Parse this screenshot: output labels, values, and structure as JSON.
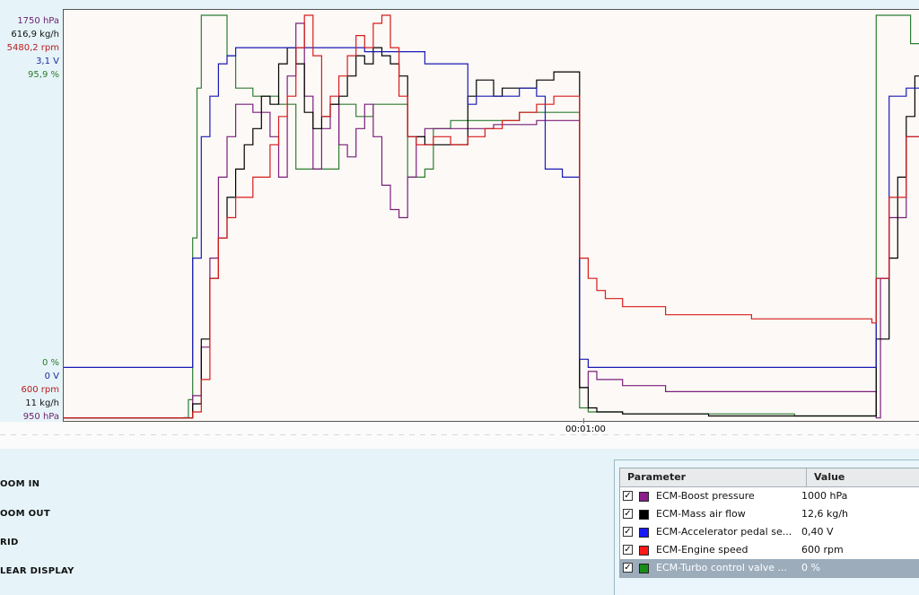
{
  "axis_labels_top": [
    {
      "text": "1750 hPa",
      "color": "#6b1f6b"
    },
    {
      "text": "616,9 kg/h",
      "color": "#111111"
    },
    {
      "text": "5480,2 rpm",
      "color": "#b81b1b"
    },
    {
      "text": "3,1 V",
      "color": "#1c2a9a"
    },
    {
      "text": "95,9 %",
      "color": "#2b7a2b"
    }
  ],
  "axis_labels_bottom": [
    {
      "text": "0 %",
      "color": "#2b7a2b"
    },
    {
      "text": "0 V",
      "color": "#1c2a9a"
    },
    {
      "text": "600 rpm",
      "color": "#b81b1b"
    },
    {
      "text": "11 kg/h",
      "color": "#111111"
    },
    {
      "text": "950 hPa",
      "color": "#6b1f6b"
    }
  ],
  "time_axis": {
    "label": "00:01:00"
  },
  "side_buttons": [
    "OOM IN",
    "OOM OUT",
    "RID",
    "LEAR DISPLAY"
  ],
  "param_table": {
    "header_param": "Parameter",
    "header_value": "Value",
    "rows": [
      {
        "name": "ECM-Boost pressure",
        "value": "1000 hPa",
        "color": "#8a1f8a",
        "checked": true,
        "selected": false
      },
      {
        "name": "ECM-Mass air flow",
        "value": "12,6 kg/h",
        "color": "#000000",
        "checked": true,
        "selected": false
      },
      {
        "name": "ECM-Accelerator pedal se...",
        "value": "0,40 V",
        "color": "#1a1aff",
        "checked": true,
        "selected": false
      },
      {
        "name": "ECM-Engine speed",
        "value": "600 rpm",
        "color": "#ff1a1a",
        "checked": true,
        "selected": false
      },
      {
        "name": "ECM-Turbo control valve ...",
        "value": "0 %",
        "color": "#1a8c1a",
        "checked": true,
        "selected": true
      }
    ]
  },
  "chart_data": {
    "type": "line",
    "xlabel": "",
    "x_ticks": [
      "00:01:00"
    ],
    "normalized_scale": [
      0,
      1
    ],
    "series": [
      {
        "name": "ECM-Turbo control valve ...",
        "color": "#2e7d32",
        "range": [
          "0 %",
          "95,9 %"
        ],
        "points": [
          [
            0,
            0.005
          ],
          [
            0.14,
            0.006
          ],
          [
            0.145,
            0.05
          ],
          [
            0.15,
            0.45
          ],
          [
            0.155,
            0.82
          ],
          [
            0.16,
            1.0
          ],
          [
            0.18,
            1.0
          ],
          [
            0.19,
            0.9
          ],
          [
            0.2,
            0.82
          ],
          [
            0.22,
            0.8
          ],
          [
            0.25,
            0.78
          ],
          [
            0.27,
            0.62
          ],
          [
            0.3,
            0.62
          ],
          [
            0.32,
            0.78
          ],
          [
            0.34,
            0.75
          ],
          [
            0.36,
            0.78
          ],
          [
            0.38,
            0.78
          ],
          [
            0.4,
            0.6
          ],
          [
            0.42,
            0.62
          ],
          [
            0.43,
            0.72
          ],
          [
            0.45,
            0.74
          ],
          [
            0.47,
            0.74
          ],
          [
            0.49,
            0.74
          ],
          [
            0.51,
            0.74
          ],
          [
            0.53,
            0.76
          ],
          [
            0.55,
            0.76
          ],
          [
            0.6,
            0.75
          ],
          [
            0.6,
            0.03
          ],
          [
            0.61,
            0.02
          ],
          [
            0.65,
            0.015
          ],
          [
            0.85,
            0.01
          ],
          [
            0.94,
            0.01
          ],
          [
            0.945,
            1.0
          ],
          [
            0.98,
            1.0
          ],
          [
            0.985,
            0.93
          ],
          [
            1.0,
            0.87
          ]
        ]
      },
      {
        "name": "ECM-Boost pressure",
        "color": "#7b1f7b",
        "range": [
          "950 hPa",
          "1750 hPa"
        ],
        "points": [
          [
            0,
            0.005
          ],
          [
            0.14,
            0.005
          ],
          [
            0.15,
            0.06
          ],
          [
            0.16,
            0.18
          ],
          [
            0.17,
            0.4
          ],
          [
            0.18,
            0.6
          ],
          [
            0.19,
            0.7
          ],
          [
            0.2,
            0.78
          ],
          [
            0.22,
            0.76
          ],
          [
            0.24,
            0.7
          ],
          [
            0.25,
            0.6
          ],
          [
            0.26,
            0.85
          ],
          [
            0.27,
            0.98
          ],
          [
            0.28,
            0.8
          ],
          [
            0.29,
            0.62
          ],
          [
            0.3,
            0.72
          ],
          [
            0.31,
            0.78
          ],
          [
            0.32,
            0.68
          ],
          [
            0.33,
            0.65
          ],
          [
            0.34,
            0.72
          ],
          [
            0.35,
            0.78
          ],
          [
            0.36,
            0.7
          ],
          [
            0.37,
            0.58
          ],
          [
            0.38,
            0.52
          ],
          [
            0.39,
            0.5
          ],
          [
            0.4,
            0.6
          ],
          [
            0.41,
            0.7
          ],
          [
            0.42,
            0.72
          ],
          [
            0.43,
            0.72
          ],
          [
            0.45,
            0.72
          ],
          [
            0.5,
            0.73
          ],
          [
            0.55,
            0.74
          ],
          [
            0.59,
            0.74
          ],
          [
            0.6,
            0.74
          ],
          [
            0.6,
            0.08
          ],
          [
            0.61,
            0.12
          ],
          [
            0.62,
            0.1
          ],
          [
            0.65,
            0.085
          ],
          [
            0.7,
            0.07
          ],
          [
            0.75,
            0.07
          ],
          [
            0.8,
            0.07
          ],
          [
            0.88,
            0.07
          ],
          [
            0.94,
            0.07
          ],
          [
            0.945,
            0.005
          ],
          [
            0.95,
            0.35
          ],
          [
            0.96,
            0.5
          ],
          [
            0.98,
            0.7
          ],
          [
            1.0,
            0.78
          ]
        ]
      },
      {
        "name": "ECM-Mass air flow",
        "color": "#000000",
        "range": [
          "11 kg/h",
          "616,9 kg/h"
        ],
        "points": [
          [
            0,
            0.005
          ],
          [
            0.14,
            0.005
          ],
          [
            0.15,
            0.04
          ],
          [
            0.16,
            0.2
          ],
          [
            0.17,
            0.35
          ],
          [
            0.18,
            0.45
          ],
          [
            0.19,
            0.55
          ],
          [
            0.2,
            0.62
          ],
          [
            0.21,
            0.68
          ],
          [
            0.22,
            0.72
          ],
          [
            0.23,
            0.8
          ],
          [
            0.24,
            0.78
          ],
          [
            0.25,
            0.88
          ],
          [
            0.26,
            0.92
          ],
          [
            0.27,
            0.88
          ],
          [
            0.28,
            0.76
          ],
          [
            0.29,
            0.72
          ],
          [
            0.3,
            0.75
          ],
          [
            0.31,
            0.78
          ],
          [
            0.32,
            0.8
          ],
          [
            0.33,
            0.85
          ],
          [
            0.34,
            0.9
          ],
          [
            0.35,
            0.88
          ],
          [
            0.36,
            0.92
          ],
          [
            0.37,
            0.9
          ],
          [
            0.38,
            0.88
          ],
          [
            0.39,
            0.85
          ],
          [
            0.4,
            0.7
          ],
          [
            0.42,
            0.68
          ],
          [
            0.44,
            0.68
          ],
          [
            0.46,
            0.68
          ],
          [
            0.47,
            0.8
          ],
          [
            0.48,
            0.84
          ],
          [
            0.5,
            0.8
          ],
          [
            0.51,
            0.82
          ],
          [
            0.53,
            0.82
          ],
          [
            0.55,
            0.84
          ],
          [
            0.57,
            0.86
          ],
          [
            0.6,
            0.86
          ],
          [
            0.6,
            0.08
          ],
          [
            0.61,
            0.03
          ],
          [
            0.62,
            0.02
          ],
          [
            0.65,
            0.015
          ],
          [
            0.75,
            0.01
          ],
          [
            0.88,
            0.01
          ],
          [
            0.94,
            0.01
          ],
          [
            0.945,
            0.2
          ],
          [
            0.96,
            0.4
          ],
          [
            0.97,
            0.6
          ],
          [
            0.98,
            0.75
          ],
          [
            0.99,
            0.85
          ],
          [
            1.0,
            0.78
          ]
        ]
      },
      {
        "name": "ECM-Accelerator pedal se...",
        "color": "#1a1ab5",
        "range": [
          "0 V",
          "3,1 V"
        ],
        "points": [
          [
            0,
            0.13
          ],
          [
            0.14,
            0.13
          ],
          [
            0.15,
            0.4
          ],
          [
            0.16,
            0.7
          ],
          [
            0.17,
            0.8
          ],
          [
            0.18,
            0.88
          ],
          [
            0.19,
            0.9
          ],
          [
            0.2,
            0.92
          ],
          [
            0.22,
            0.92
          ],
          [
            0.25,
            0.92
          ],
          [
            0.3,
            0.92
          ],
          [
            0.35,
            0.91
          ],
          [
            0.4,
            0.91
          ],
          [
            0.42,
            0.88
          ],
          [
            0.44,
            0.88
          ],
          [
            0.46,
            0.88
          ],
          [
            0.47,
            0.78
          ],
          [
            0.48,
            0.8
          ],
          [
            0.5,
            0.8
          ],
          [
            0.53,
            0.82
          ],
          [
            0.55,
            0.8
          ],
          [
            0.56,
            0.62
          ],
          [
            0.58,
            0.6
          ],
          [
            0.6,
            0.6
          ],
          [
            0.6,
            0.15
          ],
          [
            0.61,
            0.13
          ],
          [
            0.65,
            0.13
          ],
          [
            0.75,
            0.13
          ],
          [
            0.85,
            0.13
          ],
          [
            0.94,
            0.13
          ],
          [
            0.945,
            0.35
          ],
          [
            0.96,
            0.8
          ],
          [
            0.98,
            0.82
          ],
          [
            1.0,
            0.8
          ]
        ]
      },
      {
        "name": "ECM-Engine speed",
        "color": "#d61c1c",
        "range": [
          "600 rpm",
          "5480,2 rpm"
        ],
        "points": [
          [
            0,
            0.005
          ],
          [
            0.14,
            0.005
          ],
          [
            0.15,
            0.02
          ],
          [
            0.16,
            0.1
          ],
          [
            0.17,
            0.35
          ],
          [
            0.18,
            0.45
          ],
          [
            0.19,
            0.5
          ],
          [
            0.2,
            0.55
          ],
          [
            0.22,
            0.6
          ],
          [
            0.24,
            0.68
          ],
          [
            0.25,
            0.75
          ],
          [
            0.26,
            0.8
          ],
          [
            0.27,
            0.92
          ],
          [
            0.28,
            1.0
          ],
          [
            0.29,
            0.9
          ],
          [
            0.3,
            0.75
          ],
          [
            0.31,
            0.8
          ],
          [
            0.32,
            0.85
          ],
          [
            0.33,
            0.9
          ],
          [
            0.34,
            0.95
          ],
          [
            0.35,
            0.92
          ],
          [
            0.36,
            0.98
          ],
          [
            0.37,
            1.0
          ],
          [
            0.38,
            0.92
          ],
          [
            0.39,
            0.8
          ],
          [
            0.4,
            0.7
          ],
          [
            0.41,
            0.68
          ],
          [
            0.43,
            0.7
          ],
          [
            0.45,
            0.68
          ],
          [
            0.47,
            0.7
          ],
          [
            0.49,
            0.72
          ],
          [
            0.51,
            0.74
          ],
          [
            0.53,
            0.76
          ],
          [
            0.55,
            0.78
          ],
          [
            0.57,
            0.8
          ],
          [
            0.6,
            0.8
          ],
          [
            0.6,
            0.4
          ],
          [
            0.61,
            0.35
          ],
          [
            0.62,
            0.32
          ],
          [
            0.63,
            0.3
          ],
          [
            0.65,
            0.28
          ],
          [
            0.7,
            0.26
          ],
          [
            0.75,
            0.26
          ],
          [
            0.8,
            0.25
          ],
          [
            0.85,
            0.25
          ],
          [
            0.9,
            0.25
          ],
          [
            0.94,
            0.24
          ],
          [
            0.945,
            0.35
          ],
          [
            0.96,
            0.55
          ],
          [
            0.98,
            0.7
          ],
          [
            1.0,
            0.78
          ]
        ]
      }
    ]
  }
}
